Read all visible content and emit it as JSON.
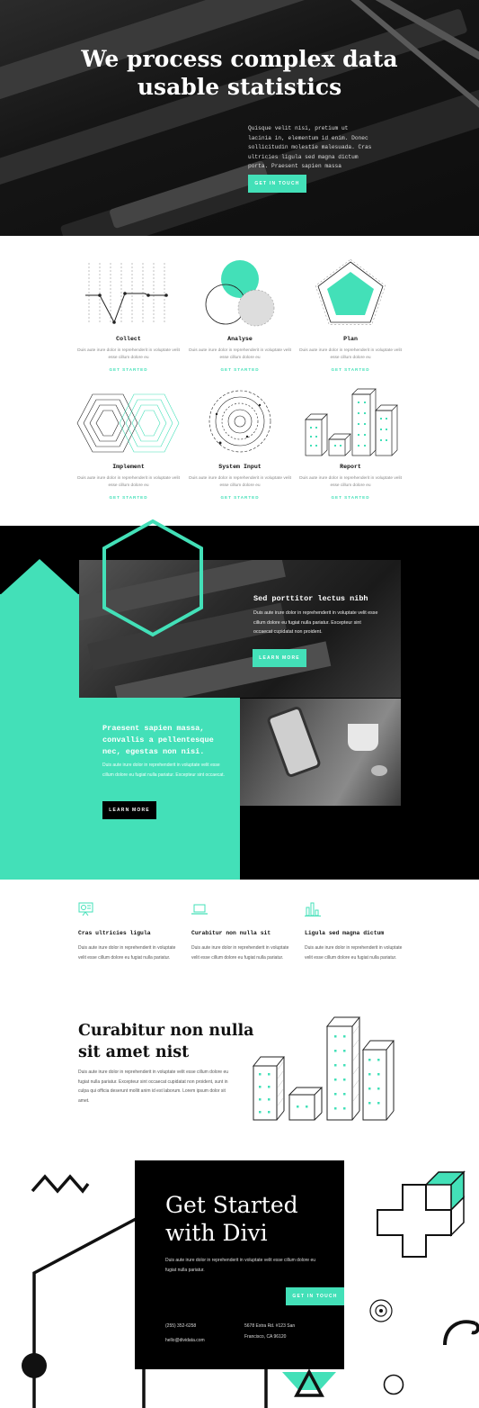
{
  "hero": {
    "title_line1": "We process complex data",
    "title_line2": "usable statistics",
    "text": "Quisque velit nisi, pretium ut lacinia in, elementum id enim. Donec sollicitudin molestie malesuada. Cras ultricies ligula sed magna dictum porta. Praesent sapien massa",
    "button": "GET IN TOUCH"
  },
  "services": [
    {
      "title": "Collect",
      "text": "Duis aute irure dolor in reprehenderit in voluptate velit esse cillum dolore eu",
      "link": "GET STARTED",
      "icon": "line-chart-icon"
    },
    {
      "title": "Analyse",
      "text": "Duis aute irure dolor in reprehenderit in voluptate velit esse cillum dolore eu",
      "link": "GET STARTED",
      "icon": "venn-icon"
    },
    {
      "title": "Plan",
      "text": "Duis aute irure dolor in reprehenderit in voluptate velit esse cillum dolore eu",
      "link": "GET STARTED",
      "icon": "pentagon-icon"
    },
    {
      "title": "Implement",
      "text": "Duis aute irure dolor in reprehenderit in voluptate velit esse cillum dolore eu",
      "link": "GET STARTED",
      "icon": "hexagon-icon"
    },
    {
      "title": "System Input",
      "text": "Duis aute irure dolor in reprehenderit in voluptate velit esse cillum dolore eu",
      "link": "GET STARTED",
      "icon": "radar-icon"
    },
    {
      "title": "Report",
      "text": "Duis aute irure dolor in reprehenderit in voluptate velit esse cillum dolore eu",
      "link": "GET STARTED",
      "icon": "buildings-icon"
    }
  ],
  "split": {
    "heading": "Sed porttitor lectus nibh",
    "text": "Duis aute irure dolor in reprehenderit in voluptate velit esse cillum dolore eu fugiat nulla pariatur. Excepteur sint occaecat cupidatat non proident.",
    "button": "LEARN MORE",
    "green_heading": "Praesent sapien massa, convallis a pellentesque nec, egestas non nisi.",
    "green_text": "Duis aute irure dolor in reprehenderit in voluptate velit esse cillum dolore eu fugiat nulla pariatur. Excepteur sint occaecat.",
    "green_button": "LEARN MORE"
  },
  "features": [
    {
      "title": "Cras ultricies ligula",
      "text": "Duis aute irure dolor in reprehenderit in voluptate velit esse cillum dolore eu fugiat nulla pariatur.",
      "icon": "projector-icon"
    },
    {
      "title": "Curabitur non nulla sit",
      "text": "Duis aute irure dolor in reprehenderit in voluptate velit esse cillum dolore eu fugiat nulla pariatur.",
      "icon": "laptop-icon"
    },
    {
      "title": "Ligula sed magna dictum",
      "text": "Duis aute irure dolor in reprehenderit in voluptate velit esse cillum dolore eu fugiat nulla pariatur.",
      "icon": "bar-chart-icon"
    }
  ],
  "about": {
    "title_line1": "Curabitur non nulla",
    "title_line2": "sit amet nist",
    "text": "Duis aute irure dolor in reprehenderit in voluptate velit esse cillum dolore eu fugiat nulla pariatur. Excepteur sint occaecat cupidatat non proident, sunt in culpa qui officia deserunt mollit anim id est laborum. Lorem ipsum dolor sit amet."
  },
  "cta": {
    "title_line1": "Get Started",
    "title_line2": "with Divi",
    "text": "Duis aute irure dolor in reprehenderit in voluptate velit esse cillum dolore eu fugiat nulla pariatur.",
    "button": "GET IN TOUCH",
    "phone": "(255) 352-6258",
    "email": "hello@dividata.com",
    "address_line1": "5678 Extra Rd. #123 San",
    "address_line2": "Francisco, CA 96120"
  },
  "colors": {
    "accent": "#43e0b8",
    "dark": "#000000"
  }
}
